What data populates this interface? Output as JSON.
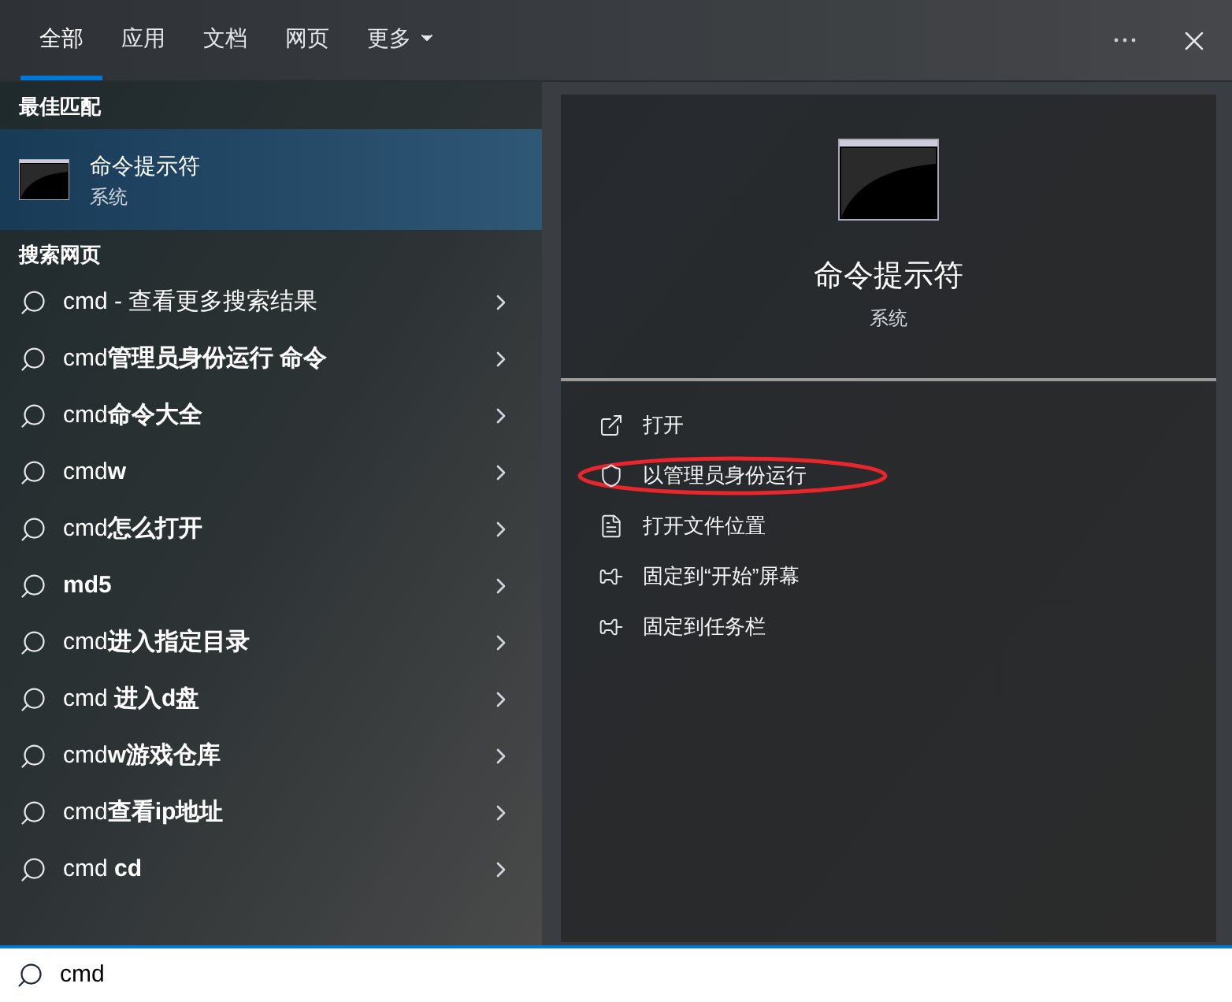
{
  "tabs": [
    {
      "label": "全部",
      "selected": true
    },
    {
      "label": "应用",
      "selected": false
    },
    {
      "label": "文档",
      "selected": false
    },
    {
      "label": "网页",
      "selected": false
    },
    {
      "label": "更多",
      "selected": false,
      "dropdown": true
    }
  ],
  "best_match": {
    "heading": "最佳匹配",
    "title": "命令提示符",
    "subtitle": "系统",
    "selected": true
  },
  "web_search": {
    "heading": "搜索网页",
    "suggestions": [
      {
        "text": "cmd - 查看更多搜索结果"
      },
      {
        "text": "cmd**管理员身份运行 命令**"
      },
      {
        "text": "cmd**命令大全**"
      },
      {
        "text": "cmd**w**"
      },
      {
        "text": "cmd**怎么打开**"
      },
      {
        "text": "**md5**"
      },
      {
        "text": "cmd**进入指定目录**"
      },
      {
        "text": "cmd **进入d盘**"
      },
      {
        "text": "cmd**w游戏仓库**"
      },
      {
        "text": "cmd**查看ip地址**"
      },
      {
        "text": "cmd **cd**"
      }
    ]
  },
  "details": {
    "title": "命令提示符",
    "subtitle": "系统",
    "actions": [
      {
        "kind": "open",
        "label": "打开",
        "circled": false
      },
      {
        "kind": "admin",
        "label": "以管理员身份运行",
        "circled": true
      },
      {
        "kind": "folder",
        "label": "打开文件位置",
        "circled": false
      },
      {
        "kind": "pin",
        "label": "固定到“开始”屏幕",
        "circled": false
      },
      {
        "kind": "pin",
        "label": "固定到任务栏",
        "circled": false
      }
    ]
  },
  "search_box": {
    "value": "cmd"
  }
}
